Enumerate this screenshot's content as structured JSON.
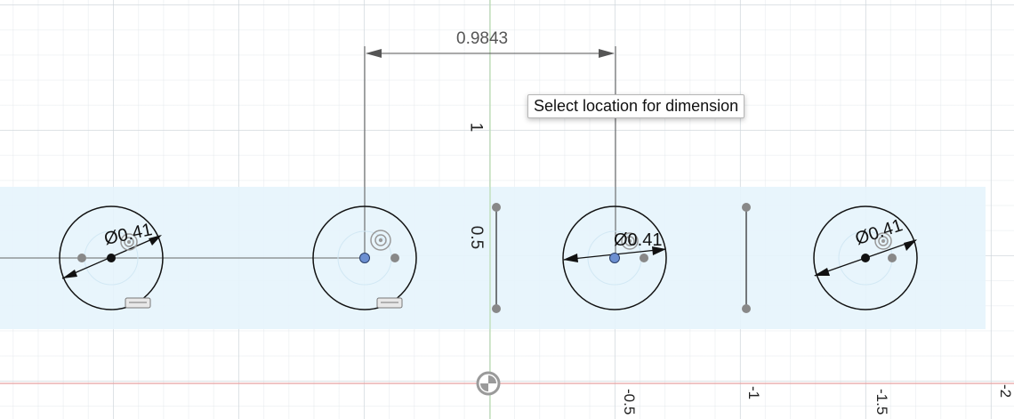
{
  "colors": {
    "selection_band": "#e6f4fc",
    "x_axis": "#e7a1a1",
    "y_axis": "#b9dcb0",
    "sketch_line": "#111111",
    "point_fill": "#6c8fd1"
  },
  "dimension": {
    "value": "0.9843"
  },
  "tooltip": {
    "text": "Select location for dimension"
  },
  "vertical_labels": {
    "upper": "1",
    "middle": "0.5"
  },
  "diameters": [
    "Ø0.41",
    "Ø0.41",
    "Ø0.41"
  ],
  "ruler_ticks": [
    "-0.5",
    "-1",
    "-1.5",
    "-2"
  ],
  "icons": {
    "coincident": "coincident-constraint-icon",
    "horizontal": "horizontal-constraint-icon",
    "origin": "origin-icon"
  }
}
